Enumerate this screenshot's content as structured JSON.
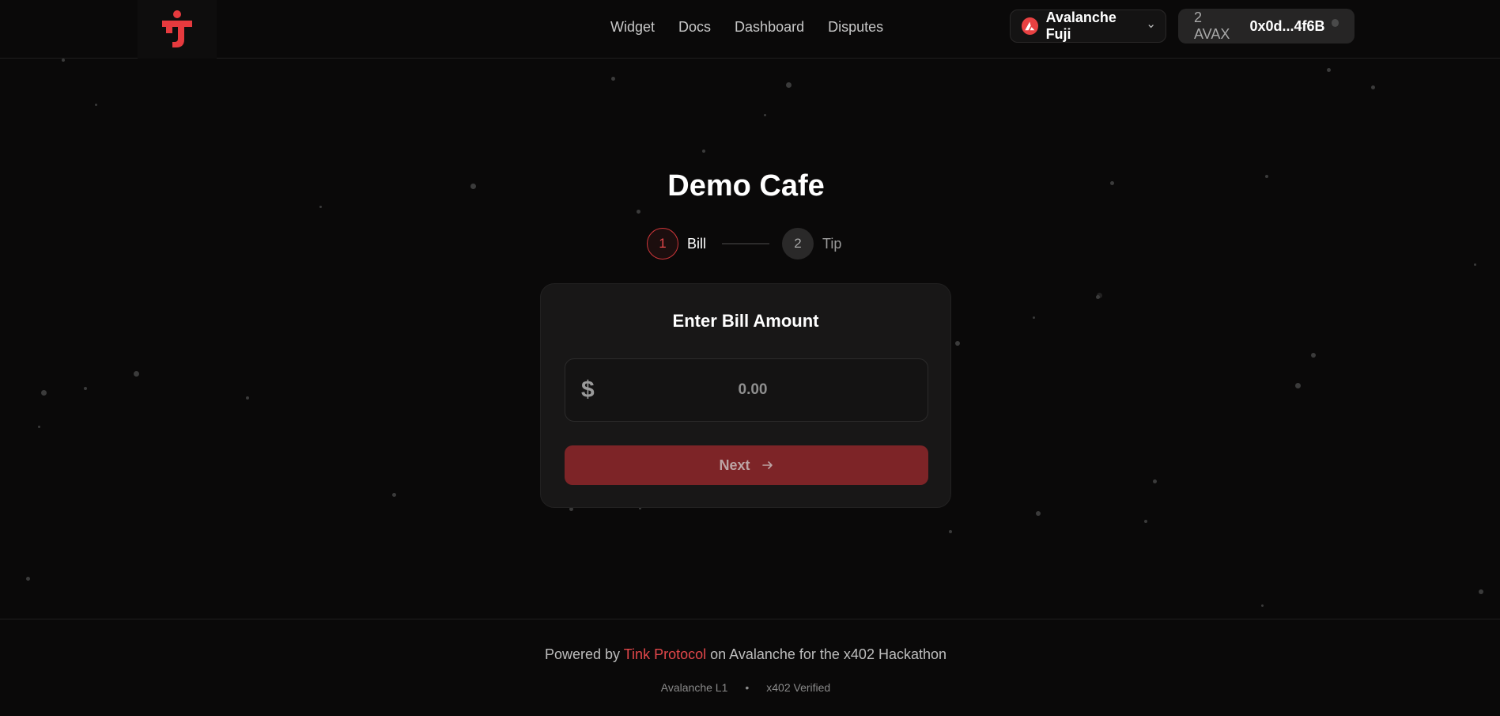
{
  "header": {
    "nav": [
      "Widget",
      "Docs",
      "Dashboard",
      "Disputes"
    ],
    "network": {
      "label": "Avalanche Fuji",
      "icon": "avalanche-icon"
    },
    "wallet": {
      "balance": "2 AVAX",
      "address": "0x0d...4f6B"
    }
  },
  "main": {
    "title": "Demo Cafe",
    "steps": [
      {
        "number": "1",
        "label": "Bill",
        "state": "active"
      },
      {
        "number": "2",
        "label": "Tip",
        "state": "inactive"
      }
    ],
    "card": {
      "title": "Enter Bill Amount",
      "currency_symbol": "$",
      "amount_placeholder": "0.00",
      "next_label": "Next"
    }
  },
  "footer": {
    "prefix": "Powered by",
    "brand": "Tink Protocol",
    "suffix": "on Avalanche for the x402 Hackathon",
    "badges": [
      "Avalanche L1",
      "x402 Verified"
    ],
    "separator": "•"
  },
  "colors": {
    "background": "#0a0909",
    "accent": "#e2474a",
    "button": "#7d2427",
    "card": "#181717"
  }
}
